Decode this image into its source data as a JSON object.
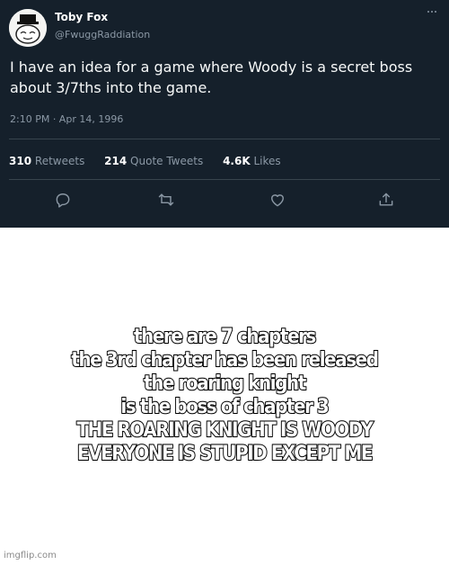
{
  "tweet": {
    "author": {
      "display_name": "Toby Fox",
      "handle": "@FwuggRaddiation"
    },
    "text": "I have an idea for a game where Woody is a secret boss about 3/7ths into the game.",
    "timestamp": "2:10 PM · Apr 14, 1996",
    "stats": {
      "retweets_count": "310",
      "retweets_label": "Retweets",
      "quote_tweets_count": "214",
      "quote_tweets_label": "Quote Tweets",
      "likes_count": "4.6K",
      "likes_label": "Likes"
    },
    "actions": [
      "reply-icon",
      "retweet-icon",
      "like-icon",
      "share-icon"
    ],
    "colors": {
      "background": "#15202b",
      "text": "#ffffff",
      "secondary_text": "#8b98a5",
      "divider": "#38444d"
    }
  },
  "caption": {
    "lines": [
      "there are 7 chapters",
      "the 3rd chapter has been released",
      "the roaring knight",
      "is the boss of chapter 3",
      "THE ROARING KNIGHT IS WOODY",
      "EVERYONE IS STUPID EXCEPT ME"
    ]
  },
  "watermark": "imgflip.com"
}
